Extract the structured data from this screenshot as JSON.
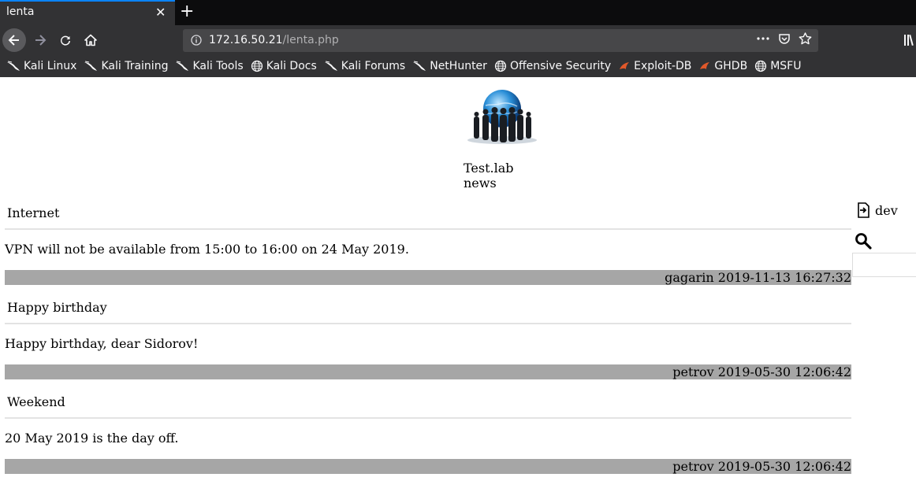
{
  "browser": {
    "tab_title": "lenta",
    "url_host": "172.16.50.21",
    "url_path": "/lenta.php",
    "bookmarks": [
      {
        "label": "Kali Linux",
        "icon": "kali-dragon-icon"
      },
      {
        "label": "Kali Training",
        "icon": "kali-dragon-icon"
      },
      {
        "label": "Kali Tools",
        "icon": "kali-dragon-icon"
      },
      {
        "label": "Kali Docs",
        "icon": "globe-icon"
      },
      {
        "label": "Kali Forums",
        "icon": "kali-dragon-icon"
      },
      {
        "label": "NetHunter",
        "icon": "kali-dragon-icon"
      },
      {
        "label": "Offensive Security",
        "icon": "globe-icon"
      },
      {
        "label": "Exploit-DB",
        "icon": "exploitdb-icon"
      },
      {
        "label": "GHDB",
        "icon": "exploitdb-icon"
      },
      {
        "label": "MSFU",
        "icon": "globe-icon"
      }
    ]
  },
  "site": {
    "title": "Test.lab news"
  },
  "news": [
    {
      "title": "Internet",
      "body": "VPN will not be available from 15:00 to 16:00 on 24 May 2019.",
      "footer": "gagarin 2019-11-13 16:27:32"
    },
    {
      "title": "Happy birthday",
      "body": "Happy birthday, dear Sidorov!",
      "footer": "petrov 2019-05-30 12:06:42"
    },
    {
      "title": "Weekend",
      "body": "20 May 2019 is the day off.",
      "footer": "petrov 2019-05-30 12:06:42"
    }
  ],
  "sidebar": {
    "login_label": "dev"
  },
  "colors": {
    "accent": "#0a84ff",
    "chrome": "#323234",
    "footer_bar": "#a6a6a6"
  }
}
